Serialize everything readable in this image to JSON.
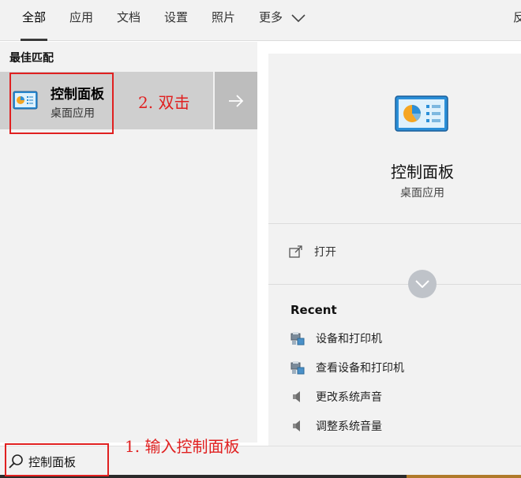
{
  "tabs": [
    {
      "label": "全部",
      "active": true
    },
    {
      "label": "应用"
    },
    {
      "label": "文档"
    },
    {
      "label": "设置"
    },
    {
      "label": "照片"
    },
    {
      "label": "更多"
    }
  ],
  "tab_cut_label": "反",
  "best_match": {
    "section_title": "最佳匹配",
    "name": "控制面板",
    "type": "桌面应用"
  },
  "detail": {
    "name": "控制面板",
    "type": "桌面应用",
    "open_label": "打开",
    "recent_title": "Recent",
    "recent_items": [
      {
        "label": "设备和打印机",
        "icon": "devices-printers-icon"
      },
      {
        "label": "查看设备和打印机",
        "icon": "devices-printers-icon"
      },
      {
        "label": "更改系统声音",
        "icon": "speaker-icon"
      },
      {
        "label": "调整系统音量",
        "icon": "speaker-icon"
      }
    ]
  },
  "search": {
    "value": "控制面板"
  },
  "annotations": {
    "step1": "1. 输入控制面板",
    "step2": "2. 双击"
  },
  "colors": {
    "annotation": "#e02020",
    "panel_bg": "#f2f2f2",
    "selected_bg": "#cfcfcf"
  }
}
